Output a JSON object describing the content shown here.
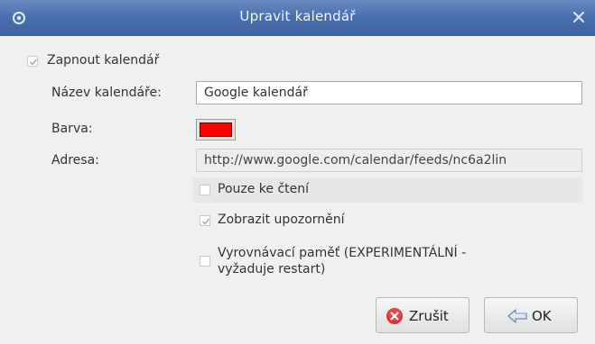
{
  "window": {
    "title": "Upravit kalendář",
    "app_icon": "gear-icon",
    "close_icon": "close-icon"
  },
  "enable": {
    "label": "Zapnout kalendář",
    "checked": true
  },
  "fields": {
    "name_label": "Název kalendáře:",
    "name_value": "Google kalendář",
    "color_label": "Barva:",
    "color_value": "#ff0000",
    "url_label": "Adresa:",
    "url_value": "http://www.google.com/calendar/feeds/nc6a2lin"
  },
  "options": {
    "readonly_label": "Pouze ke čtení",
    "readonly_checked": false,
    "show_alarms_label": "Zobrazit upozornění",
    "show_alarms_checked": true,
    "cache_label_line1": "Vyrovnávací paměť (EXPERIMENTÁLNÍ -",
    "cache_label_line2": "vyžaduje restart)",
    "cache_checked": false
  },
  "buttons": {
    "cancel_label": "Zrušit",
    "cancel_icon": "cancel-icon",
    "ok_label": "OK",
    "ok_icon": "ok-icon"
  },
  "colors": {
    "titlebar": "#4a70b0",
    "background": "#eff1ef",
    "cancel_icon": "#d9343a"
  }
}
